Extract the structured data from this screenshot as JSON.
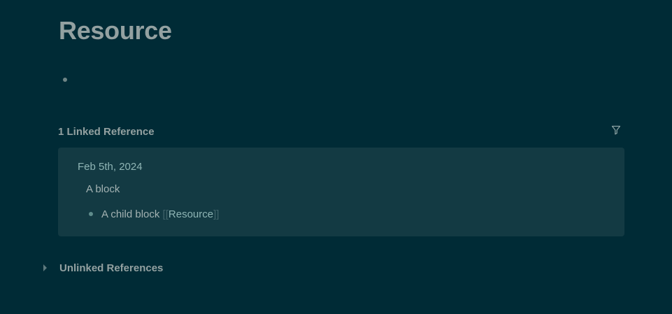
{
  "page": {
    "title": "Resource"
  },
  "linked_references": {
    "header": "1 Linked Reference",
    "filter_icon": "filter-icon",
    "items": [
      {
        "date": "Feb 5th, 2024",
        "block": "A block",
        "child": {
          "text": "A child block ",
          "ref_open": "[[",
          "ref": "Resource",
          "ref_close": "]]"
        }
      }
    ]
  },
  "unlinked_references": {
    "header": "Unlinked References",
    "caret_icon": "caret-right-icon"
  },
  "colors": {
    "background": "#002b36",
    "panel": "#133a43",
    "text": "#93a1a1",
    "link": "#8fb5b5"
  }
}
